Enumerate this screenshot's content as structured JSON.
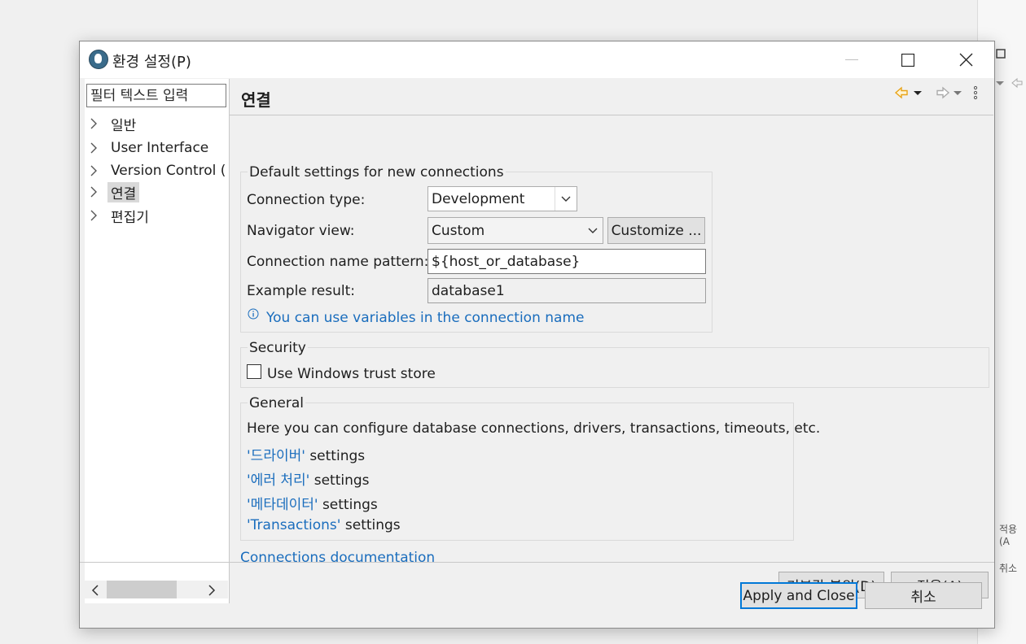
{
  "background": {
    "fragments": [
      "적용(A",
      "취소"
    ]
  },
  "dialog": {
    "title": "환경 설정(P)",
    "buttons": {
      "apply_close": "Apply and Close",
      "cancel": "취소"
    }
  },
  "tree": {
    "filter_placeholder": "필터 텍스트 입력",
    "items": [
      {
        "label": "일반"
      },
      {
        "label": "User Interface"
      },
      {
        "label": "Version Control ("
      },
      {
        "label": "연결",
        "selected": true
      },
      {
        "label": "편집기"
      }
    ]
  },
  "page": {
    "title": "연결",
    "defaults_group": {
      "title": "Default settings for new connections",
      "connection_type_label": "Connection type:",
      "connection_type_value": "Development",
      "navigator_view_label": "Navigator view:",
      "navigator_view_value": "Custom",
      "customize_button": "Customize ...",
      "name_pattern_label": "Connection name pattern:",
      "name_pattern_value": "${host_or_database}",
      "example_label": "Example result:",
      "example_value": "database1",
      "info_text": "You can use variables in the connection name"
    },
    "security_group": {
      "title": "Security",
      "trust_store_label": "Use Windows trust store",
      "trust_store_checked": false
    },
    "general_group": {
      "title": "General",
      "description": "Here you can configure database connections, drivers, transactions, timeouts, etc.",
      "links": [
        {
          "link": "'드라이버'",
          "suffix": " settings"
        },
        {
          "link": "'에러 처리'",
          "suffix": " settings"
        },
        {
          "link": "'메타데이터'",
          "suffix": " settings"
        },
        {
          "link": "'Transactions'",
          "suffix": " settings"
        }
      ]
    },
    "docs_link": "Connections documentation",
    "restore_defaults_button": "기본값 복원(D)",
    "apply_button": "적용(A)"
  },
  "colors": {
    "link": "#1a6dbd",
    "accent": "#0078d7",
    "nav_arrow": "#e8a317"
  }
}
